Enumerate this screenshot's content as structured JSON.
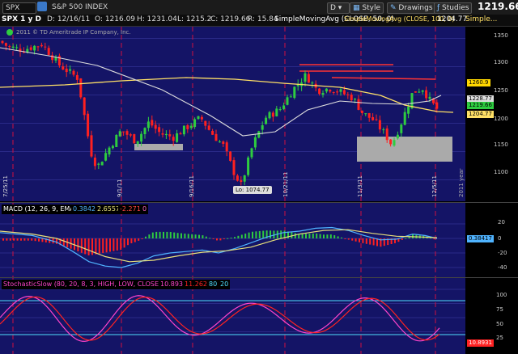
{
  "toolbar": {
    "symbol": "SPX",
    "symbol_name": "S&P 500 INDEX",
    "dropdown_label": "D",
    "style_label": "Style",
    "drawings_label": "Drawings",
    "studies_label": "Studies",
    "last_price": "1219.66"
  },
  "infobar": {
    "timeframe": "SPX 1 y D",
    "date": "D: 12/16/11",
    "open": "O: 1216.09",
    "high": "H: 1231.04",
    "low": "L: 1215.2",
    "close": "C: 1219.66",
    "range": "R: 15.84",
    "sma50_label": "SimpleMovingAvg (CLOSE, 50, 0)",
    "sma50_value": "1228.77",
    "sma100_label": "SimpleMovingAvg (CLOSE, 100, 0)",
    "sma100_value": "1204.77",
    "more_label": "Simple..."
  },
  "price_panel": {
    "copyright": "2011 © TD Ameritrade IP Company, Inc.",
    "low_label": "Lo: 1074.77",
    "year_label": "2011 year",
    "dates": [
      "7/25/11",
      "9/1/11",
      "9/16/11",
      "10/21/11",
      "11/3/11",
      "12/5/11"
    ],
    "y_ticks": [
      "1350",
      "1300",
      "1250",
      "1200",
      "1150",
      "1100"
    ],
    "tags": {
      "t1": "1260.9",
      "t2": "1228.77",
      "t3": "1219.66",
      "t4": "1204.77"
    }
  },
  "macd_panel": {
    "label": "MACD (12, 26, 9, EMA)",
    "value1": "0.3842",
    "value2": "2.6557",
    "value3": "-2.2715",
    "value4": "0",
    "y_ticks": [
      "20",
      "0",
      "-20",
      "-40"
    ],
    "tag": "0.38417"
  },
  "stoch_panel": {
    "label": "StochasticSlow (80, 20, 8, 3, HIGH, LOW, CLOSE, SMA)",
    "value1": "10.8931",
    "value2": "11.2621",
    "value3": "80",
    "value4": "20",
    "y_ticks": [
      "100",
      "75",
      "50",
      "25"
    ],
    "tag": "10.8931"
  },
  "colors": {
    "plot_bg": "#141466",
    "up": "#2ecc40",
    "down": "#ff2020",
    "sma50": "#ffe066",
    "sma100": "#dddddd",
    "macd_line": "#4fb3ff",
    "macd_signal": "#e8e07a",
    "stoch_k": "#ff44cc",
    "stoch_d": "#ff2222",
    "resistance": "#ff3333"
  }
}
